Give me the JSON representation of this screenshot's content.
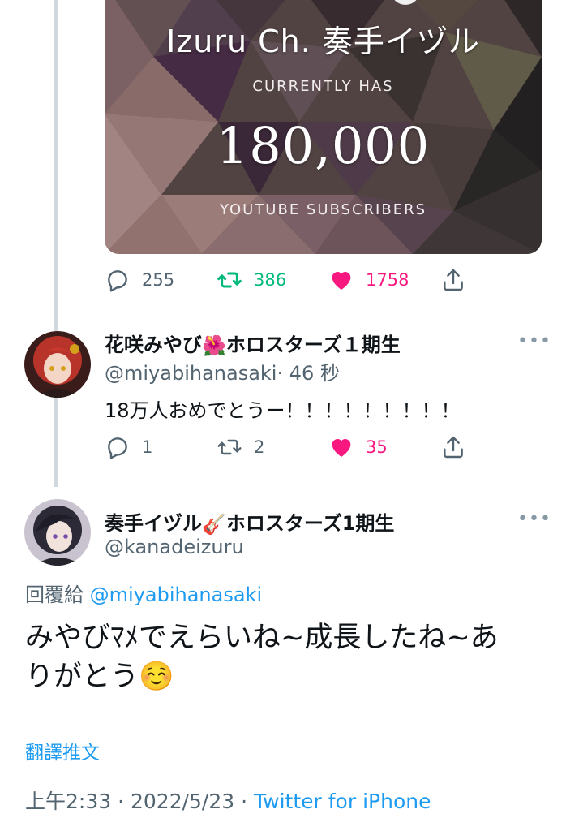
{
  "card": {
    "title": "Izuru Ch. 奏手イヅル",
    "subtitle": "CURRENTLY HAS",
    "count": "180,000",
    "footer": "YOUTUBE SUBSCRIBERS"
  },
  "tweet1_actions": {
    "replies": "255",
    "retweets": "386",
    "likes": "1758"
  },
  "reply1": {
    "name_prefix": "花咲みやび",
    "name_emoji": "🌺",
    "name_suffix": "ホロスターズ１期生",
    "handle": "@miyabihanasaki",
    "time": "· 46 秒",
    "text": "18万人おめでとうー！！！！！！！！！",
    "replies": "1",
    "retweets": "2",
    "likes": "35"
  },
  "reply2": {
    "name_prefix": "奏手イヅル",
    "name_emoji": "🎸",
    "name_suffix": "ホロスターズ1期生",
    "handle": "@kanadeizuru",
    "reply_label": "回覆給",
    "reply_target": "@miyabihanasaki",
    "text_line1": "みやびﾏﾒでえらいね~成長したね~あ",
    "text_line2": "りがとう☺️",
    "translate": "翻譯推文",
    "time": "上午2:33 · 2022/5/23 ·",
    "client": "Twitter for iPhone"
  },
  "more_glyph": "•••",
  "colors": {
    "like": "#f91880",
    "retweet": "#00ba7c",
    "link": "#1d9bf0",
    "muted": "#536471"
  }
}
